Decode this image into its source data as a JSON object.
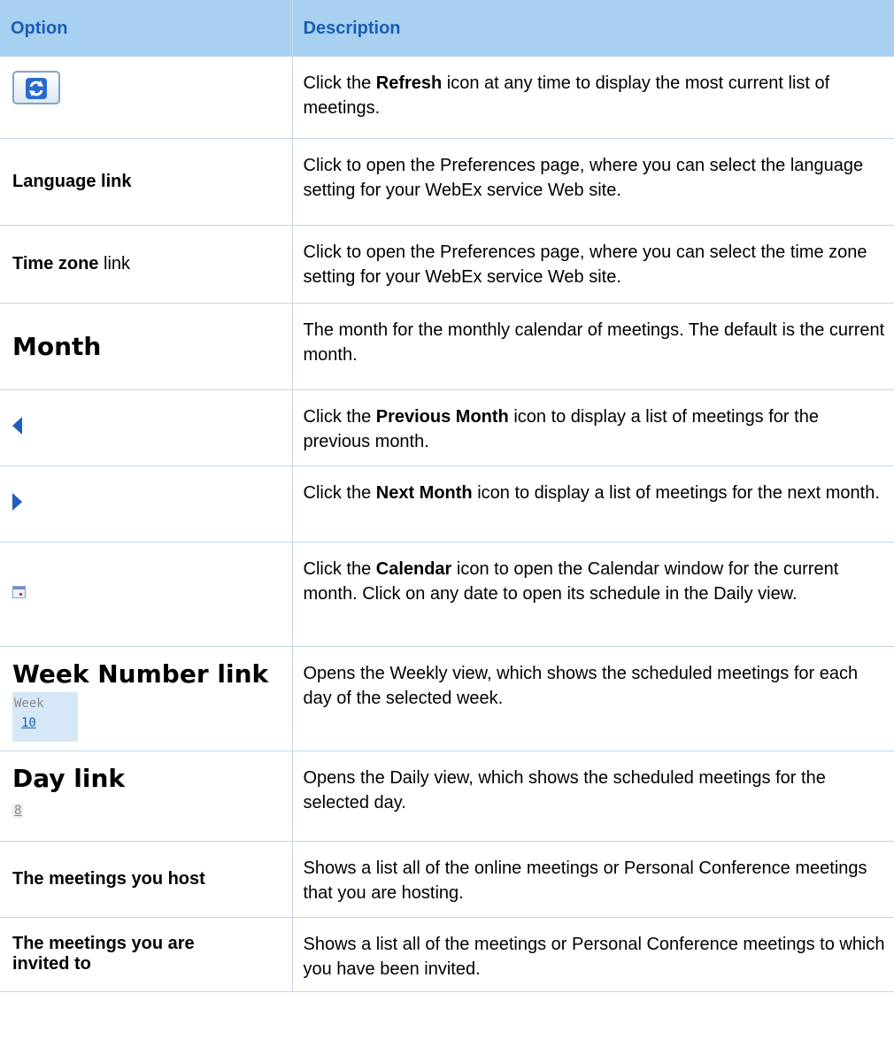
{
  "header": {
    "option": "Option",
    "description": "Description"
  },
  "rows": [
    {
      "icon": "refresh-icon",
      "desc": [
        "Click the ",
        "Refresh",
        " icon at any time to display the most current list of meetings."
      ]
    },
    {
      "option": "Language link",
      "desc": [
        "Click to open the Preferences page, where you can select the language setting for your WebEx service Web site."
      ]
    },
    {
      "option_bold": "Time zone",
      "option_rest": " link",
      "desc": [
        "Click to open the Preferences page, where you can select the time zone setting for your WebEx service Web site."
      ]
    },
    {
      "option": "Month",
      "desc": [
        "The month for the monthly calendar of meetings. The default is the current month."
      ]
    },
    {
      "icon": "previous-month-icon",
      "desc": [
        "Click the ",
        "Previous Month",
        " icon to display a list of meetings for the previous month."
      ]
    },
    {
      "icon": "next-month-icon",
      "desc": [
        "Click the ",
        "Next Month",
        " icon to display a list of meetings for the next month."
      ]
    },
    {
      "icon": "calendar-icon",
      "desc": [
        "Click the ",
        "Calendar",
        " icon to open the Calendar window for the current month. Click on any date to open its schedule in the Daily view."
      ]
    },
    {
      "option": "Week Number link",
      "week_label": "Week",
      "week_number": "10",
      "desc": [
        "Opens the Weekly view, which shows the scheduled meetings for each day of the selected week."
      ]
    },
    {
      "option": "Day link",
      "day_number": "8",
      "desc": [
        "Opens the Daily view, which shows the scheduled meetings for the selected day."
      ]
    },
    {
      "option": "The meetings you host",
      "desc": [
        "Shows a list all of the online meetings or Personal Conference meetings that you are hosting."
      ]
    },
    {
      "option": "The meetings you are invited to",
      "desc": [
        "Shows a list all of the meetings or Personal Conference meetings to which you have been invited."
      ]
    }
  ],
  "colors": {
    "header_bg": "#a8d0f0",
    "header_text": "#1a5fb4",
    "icon_blue": "#1f5fb8",
    "border": "#c4d6e6"
  }
}
